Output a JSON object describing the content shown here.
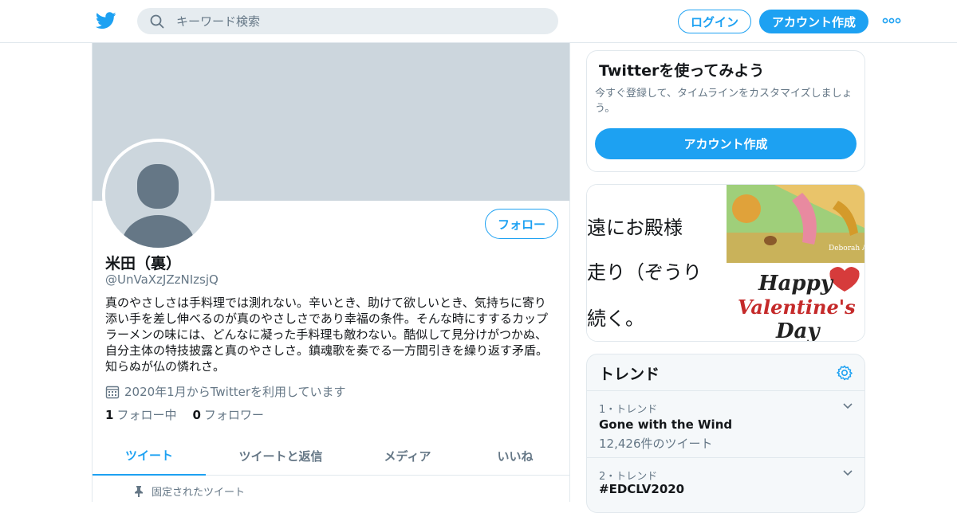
{
  "header": {
    "search_placeholder": "キーワード検索",
    "login_label": "ログイン",
    "signup_label": "アカウント作成"
  },
  "profile": {
    "name": "米田（裏）",
    "handle": "@UnVaXzJZzNIzsjQ",
    "bio": "真のやさしさは手料理では測れない。辛いとき、助けて欲しいとき、気持ちに寄り添い手を差し伸べるのが真のやさしさであり幸福の条件。そんな時にすするカップラーメンの味には、どんなに凝った手料理も敵わない。酷似して見分けがつかぬ、自分主体の特技披露と真のやさしさ。鎮魂歌を奏でる一方間引きを繰り返す矛盾。知らぬが仏の憐れさ。",
    "joined": "2020年1月からTwitterを利用しています",
    "following_count": "1",
    "following_label": "フォロー中",
    "followers_count": "0",
    "followers_label": "フォロワー",
    "follow_button": "フォロー"
  },
  "tabs": [
    {
      "label": "ツイート",
      "active": true
    },
    {
      "label": "ツイートと返信",
      "active": false
    },
    {
      "label": "メディア",
      "active": false
    },
    {
      "label": "いいね",
      "active": false
    }
  ],
  "pinned_label": "固定されたツイート",
  "sidebar": {
    "try_card": {
      "title": "Twitterを使ってみよう",
      "text": "今すぐ登録して、タイムラインをカスタマイズしましょう。",
      "button": "アカウント作成"
    },
    "media_card": {
      "lines": [
        "遠にお殿様",
        "走り（ぞうり",
        "続く。"
      ],
      "art_top_caption": "Deborah Allwright",
      "art_bottom_text": [
        "Happy",
        "Valentine's",
        "Day"
      ]
    },
    "trends": {
      "title": "トレンド",
      "items": [
        {
          "meta": "1・トレンド",
          "name": "Gone with the Wind",
          "count": "12,426件のツイート"
        },
        {
          "meta": "2・トレンド",
          "name": "#EDCLV2020",
          "count": ""
        }
      ]
    }
  },
  "colors": {
    "accent": "#1da1f2",
    "banner": "#ccd6dd",
    "muted_text": "#657786",
    "border": "#e1e8ed"
  },
  "icons": [
    "twitter-bird-icon",
    "search-icon",
    "more-dots-icon",
    "calendar-icon",
    "pin-icon",
    "gear-icon",
    "chevron-down-icon"
  ]
}
